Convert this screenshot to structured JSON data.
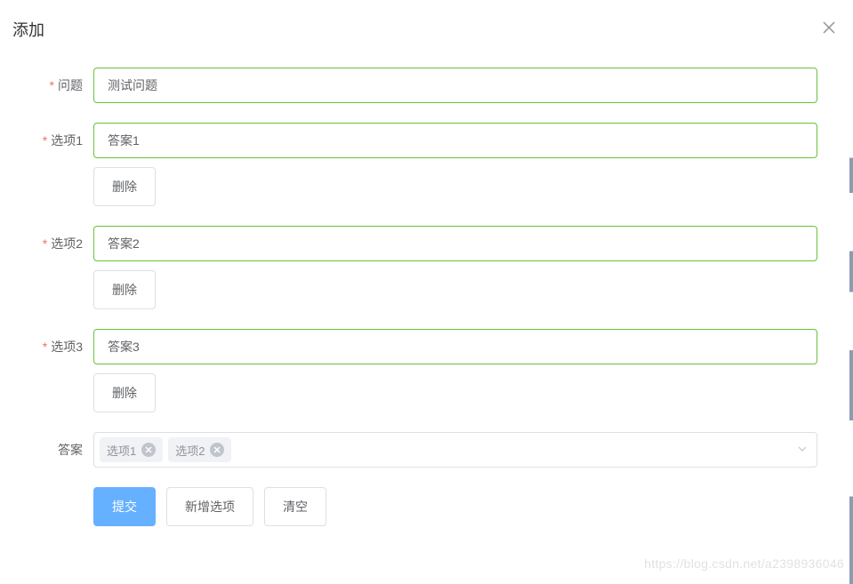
{
  "dialog": {
    "title": "添加"
  },
  "form": {
    "question": {
      "label": "问题",
      "value": "测试问题"
    },
    "options": [
      {
        "label": "选项1",
        "value": "答案1",
        "deleteLabel": "删除"
      },
      {
        "label": "选项2",
        "value": "答案2",
        "deleteLabel": "删除"
      },
      {
        "label": "选项3",
        "value": "答案3",
        "deleteLabel": "删除"
      }
    ],
    "answer": {
      "label": "答案",
      "selected": [
        {
          "text": "选项1"
        },
        {
          "text": "选项2"
        }
      ]
    },
    "buttons": {
      "submit": "提交",
      "addOption": "新增选项",
      "clear": "清空"
    }
  },
  "watermark": "https://blog.csdn.net/a2398936046"
}
